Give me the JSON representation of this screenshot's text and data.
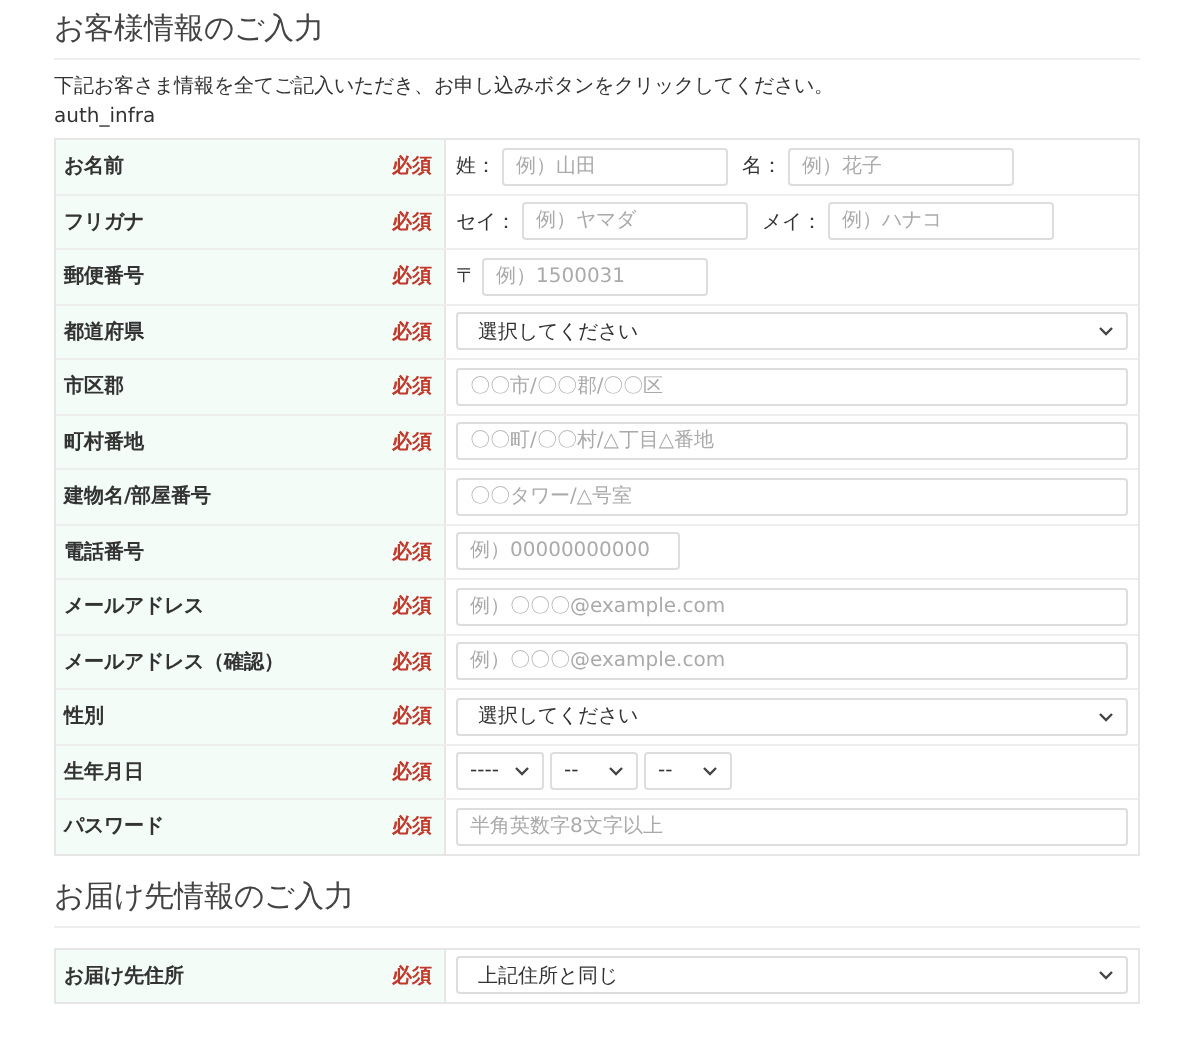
{
  "sections": [
    {
      "title": "お客様情報のご入力",
      "description": "下記お客さま情報を全てご記入いただき、お申し込みボタンをクリックしてください。",
      "note": "auth_infra",
      "rows": [
        {
          "label": "お名前",
          "required_text": "必須",
          "kind": "labeled",
          "fields": [
            {
              "label": "姓：",
              "placeholder": "例）山田"
            },
            {
              "label": "名：",
              "placeholder": "例）花子"
            }
          ]
        },
        {
          "label": "フリガナ",
          "required_text": "必須",
          "kind": "labeled",
          "fields": [
            {
              "label": "セイ：",
              "placeholder": "例）ヤマダ"
            },
            {
              "label": "メイ：",
              "placeholder": "例）ハナコ"
            }
          ]
        },
        {
          "label": "郵便番号",
          "required_text": "必須",
          "kind": "labeled",
          "fields": [
            {
              "label": "〒",
              "placeholder": "例）1500031"
            }
          ]
        },
        {
          "label": "都道府県",
          "required_text": "必須",
          "kind": "select",
          "value": "選択してください"
        },
        {
          "label": "市区郡",
          "required_text": "必須",
          "kind": "text",
          "placeholder": "〇〇市/〇〇郡/〇〇区"
        },
        {
          "label": "町村番地",
          "required_text": "必須",
          "kind": "text",
          "placeholder": "〇〇町/〇〇村/△丁目△番地"
        },
        {
          "label": "建物名/部屋番号",
          "kind": "text",
          "placeholder": "〇〇タワー/△号室"
        },
        {
          "label": "電話番号",
          "required_text": "必須",
          "kind": "short",
          "placeholder": "例）00000000000"
        },
        {
          "label": "メールアドレス",
          "required_text": "必須",
          "kind": "text",
          "placeholder": "例）〇〇〇@example.com"
        },
        {
          "label": "メールアドレス（確認）",
          "required_text": "必須",
          "kind": "text",
          "placeholder": "例）〇〇〇@example.com"
        },
        {
          "label": "性別",
          "required_text": "必須",
          "kind": "select",
          "value": "選択してください"
        },
        {
          "label": "生年月日",
          "required_text": "必須",
          "kind": "date",
          "values": [
            "----",
            "--",
            "--"
          ]
        },
        {
          "label": "パスワード",
          "required_text": "必須",
          "kind": "text",
          "placeholder": "半角英数字8文字以上"
        }
      ]
    },
    {
      "title": "お届け先情報のご入力",
      "rows": [
        {
          "label": "お届け先住所",
          "required_text": "必須",
          "kind": "select",
          "value": "上記住所と同じ"
        }
      ]
    }
  ]
}
